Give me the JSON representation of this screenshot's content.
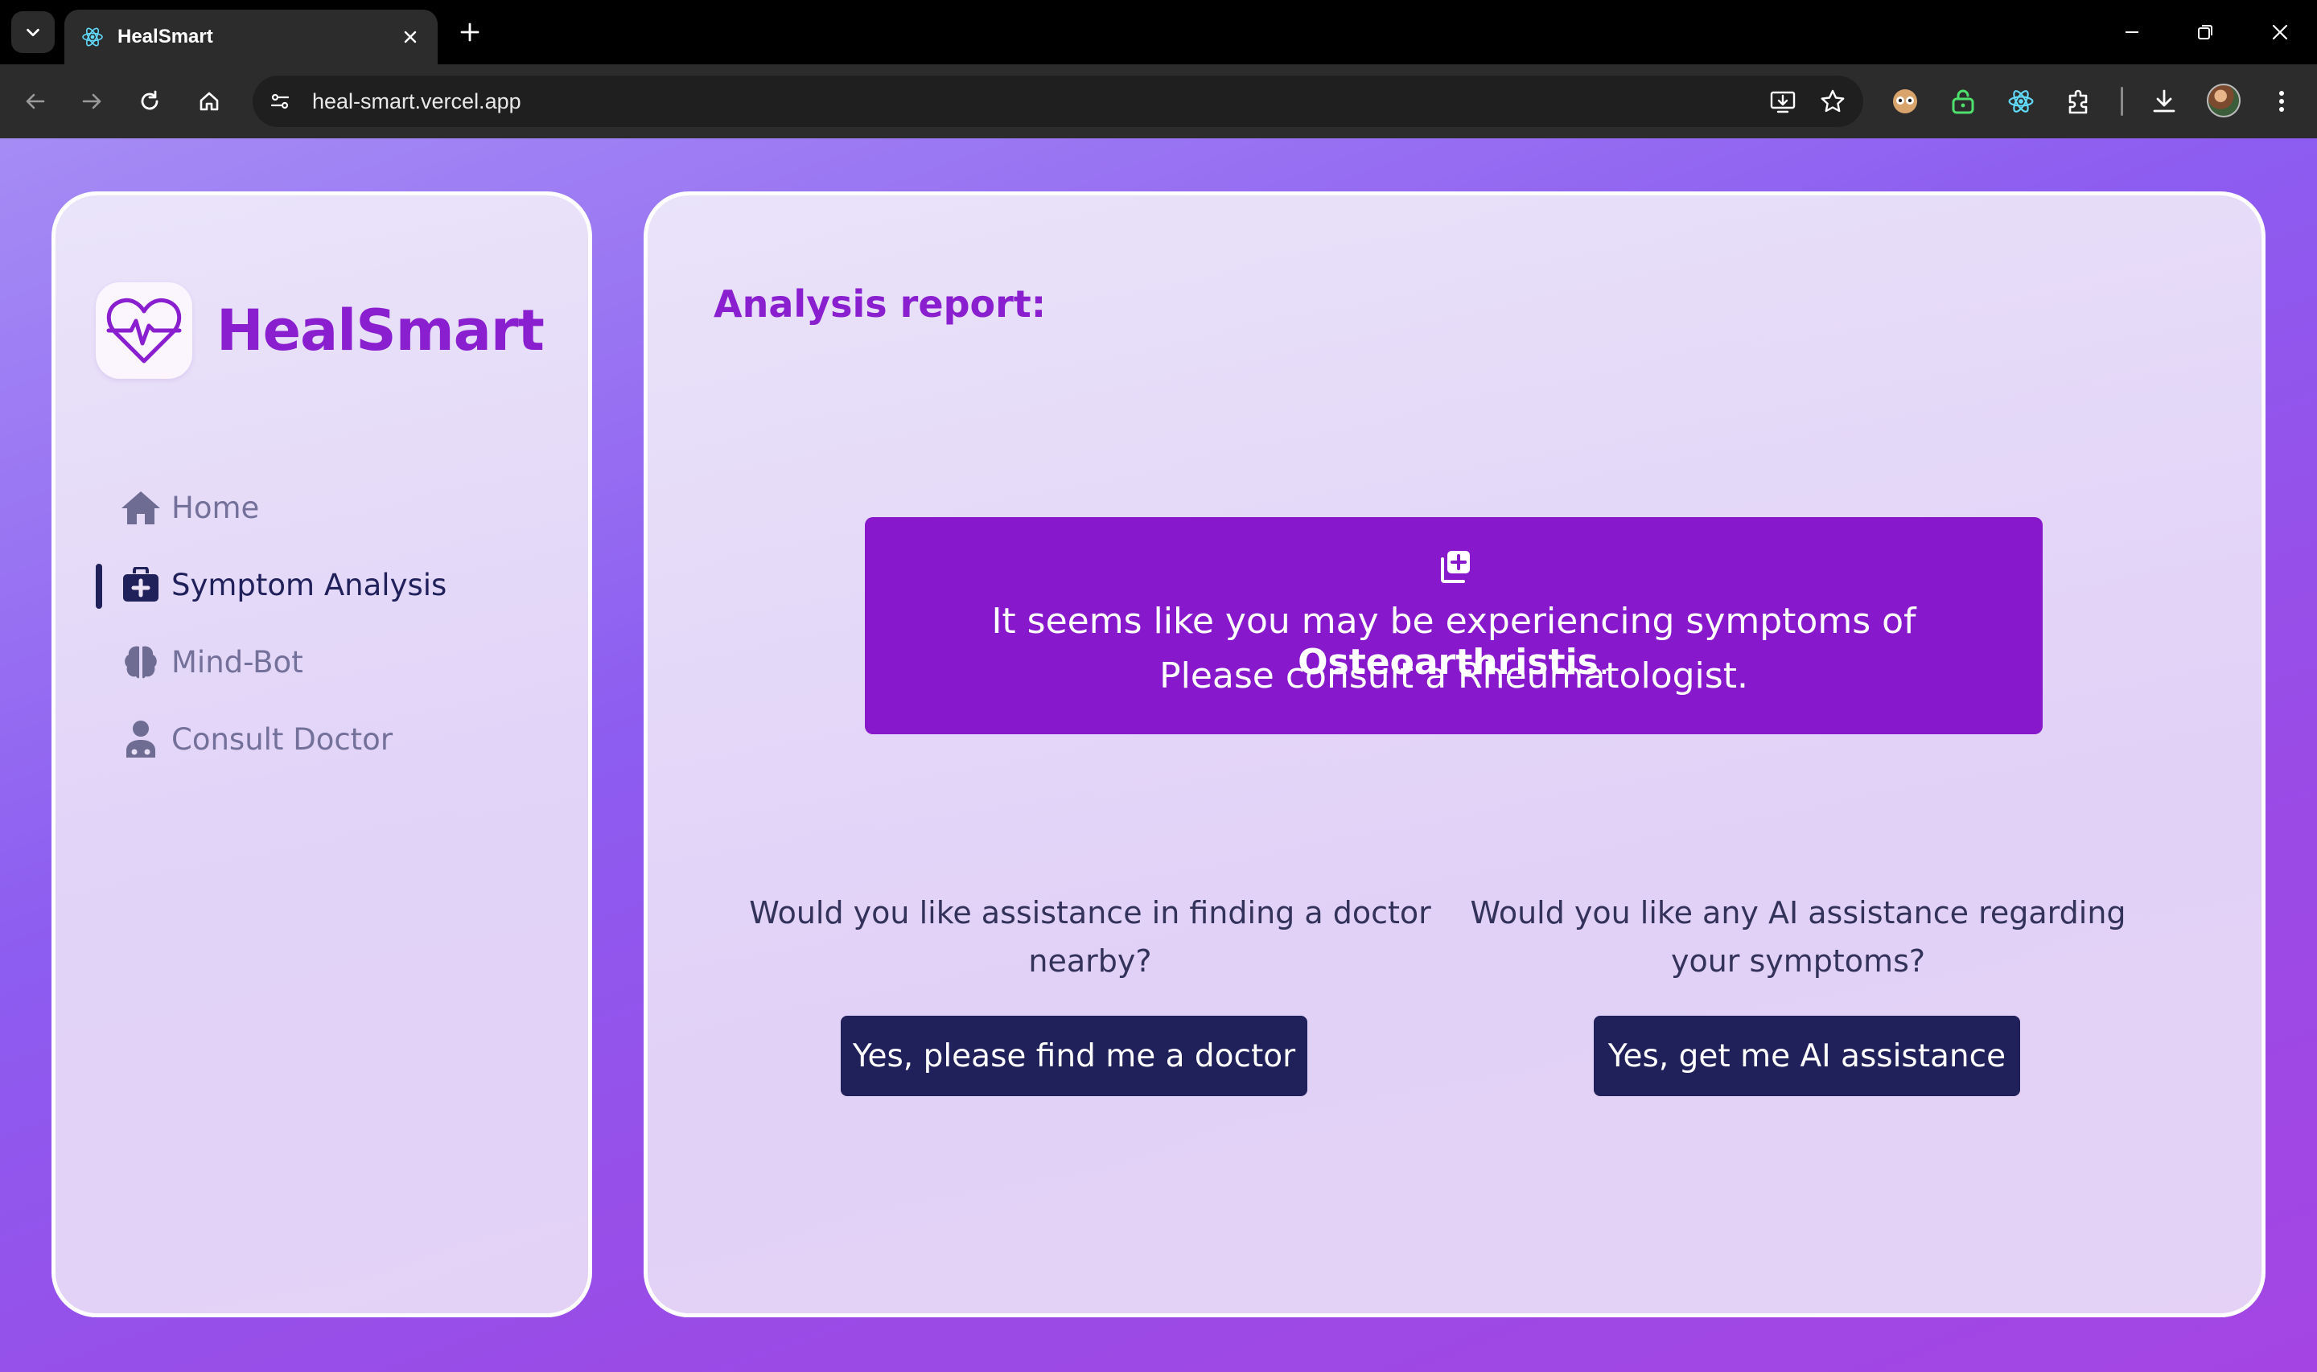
{
  "browser": {
    "tab_title": "HealSmart",
    "url": "heal-smart.vercel.app"
  },
  "sidebar": {
    "brand": "HealSmart",
    "items": [
      {
        "label": "Home",
        "icon": "home-icon",
        "active": false
      },
      {
        "label": "Symptom Analysis",
        "icon": "medkit-icon",
        "active": true
      },
      {
        "label": "Mind-Bot",
        "icon": "brain-icon",
        "active": false
      },
      {
        "label": "Consult Doctor",
        "icon": "doctor-icon",
        "active": false
      }
    ]
  },
  "main": {
    "title": "Analysis report:",
    "result": {
      "prefix": "It seems like you may be experiencing symptoms of ",
      "condition": "Osteoarthristis",
      "suffix": ".",
      "advice": "Please consult a Rheumatologist."
    },
    "doctor_question": "Would you like assistance in finding a doctor nearby?",
    "doctor_button": "Yes, please find me a doctor",
    "ai_question": "Would you like any AI assistance regarding your symptoms?",
    "ai_button": "Yes, get me AI assistance"
  },
  "colors": {
    "accent": "#8a1fcf",
    "result_bg": "#8718cc",
    "button_bg": "#20205a"
  }
}
